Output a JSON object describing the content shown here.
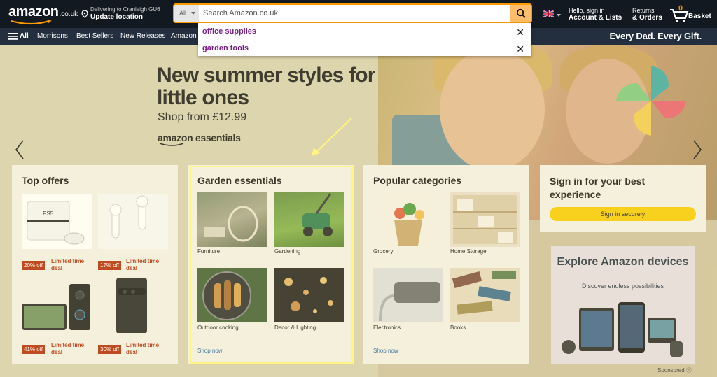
{
  "header": {
    "logo_text": "amazon",
    "logo_tld": ".co.uk",
    "deliver_line1": "Delivering to Cranleigh GU6",
    "deliver_line2": "Update location",
    "search_category": "All",
    "search_placeholder": "Search Amazon.co.uk",
    "account_line1": "Hello, sign in",
    "account_line2": "Account & Lists",
    "returns_line1": "Returns",
    "returns_line2": "& Orders",
    "basket_count": "0",
    "basket_label": "Basket"
  },
  "suggestions": [
    {
      "text": "office supplies"
    },
    {
      "text": "garden tools"
    }
  ],
  "nav": {
    "all": "All",
    "items": [
      "Morrisons",
      "Best Sellers",
      "New Releases",
      "Amazon"
    ],
    "promo": "Every Dad. Every Gift."
  },
  "hero": {
    "headline": "New summer styles for little ones",
    "subline": "Shop from £12.99",
    "brand": "amazon essentials"
  },
  "cards": {
    "top_offers": {
      "title": "Top offers",
      "deals": [
        {
          "badge": "20% off",
          "label": "Limited time deal"
        },
        {
          "badge": "17% off",
          "label": "Limited time deal"
        },
        {
          "badge": "41% off",
          "label": "Limited time deal"
        },
        {
          "badge": "30% off",
          "label": "Limited time deal"
        }
      ]
    },
    "garden": {
      "title": "Garden essentials",
      "tiles": [
        "Furniture",
        "Gardening",
        "Outdoor cooking",
        "Decor & Lighting"
      ],
      "shop_now": "Shop now"
    },
    "popular": {
      "title": "Popular categories",
      "tiles": [
        "Grocery",
        "Home Storage",
        "Electronics",
        "Books"
      ],
      "shop_now": "Shop now"
    },
    "signin": {
      "title": "Sign in for your best experience",
      "button": "Sign in securely"
    },
    "devices": {
      "title": "Explore Amazon devices",
      "subtitle": "Discover endless possibilities",
      "sponsored": "Sponsored"
    }
  },
  "colors": {
    "header_bg": "#131921",
    "nav_bg": "#232f3e",
    "search_border": "#ff9900",
    "search_button": "#febd69",
    "deal_badge": "#b12704",
    "suggestion_text": "#7a1e8a",
    "highlight": "#fff37a"
  }
}
